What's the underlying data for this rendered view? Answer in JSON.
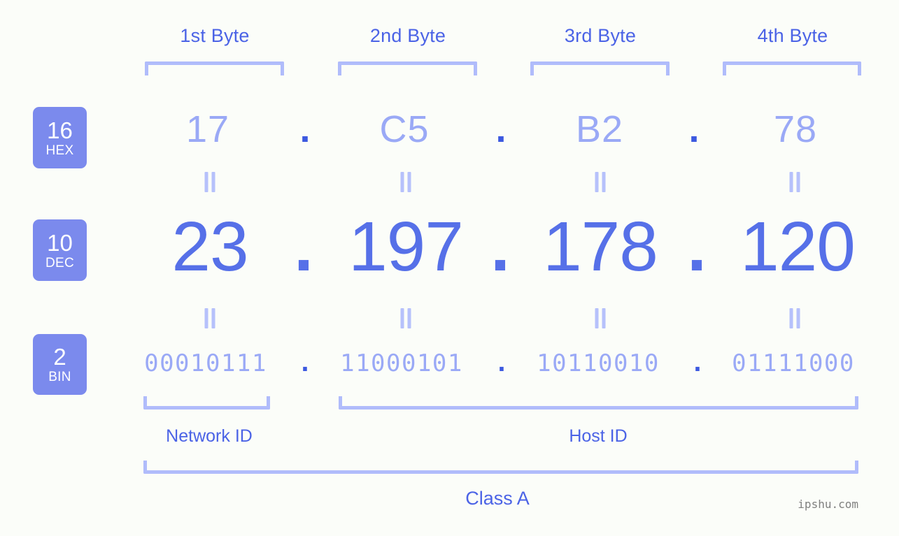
{
  "meta": {
    "ip_decimal": "23.197.178.120",
    "ip_class": "Class A",
    "watermark": "ipshu.com",
    "background_color": "#fbfdf9",
    "accent_color": "#5670e8",
    "light_accent_color": "#9aa9f6",
    "bracket_color": "#b0bcfb",
    "badge_color": "#7b8aed"
  },
  "byte_headers": [
    {
      "label": "1st Byte"
    },
    {
      "label": "2nd Byte"
    },
    {
      "label": "3rd Byte"
    },
    {
      "label": "4th Byte"
    }
  ],
  "bases": [
    {
      "number": "16",
      "name": "HEX"
    },
    {
      "number": "10",
      "name": "DEC"
    },
    {
      "number": "2",
      "name": "BIN"
    }
  ],
  "rows": {
    "hex": {
      "base_number": "16",
      "base_name": "HEX",
      "values": [
        "17",
        "C5",
        "B2",
        "78"
      ],
      "separator": "."
    },
    "dec": {
      "base_number": "10",
      "base_name": "DEC",
      "values": [
        "23",
        "197",
        "178",
        "120"
      ],
      "separator": "."
    },
    "bin": {
      "base_number": "2",
      "base_name": "BIN",
      "values": [
        "00010111",
        "11000101",
        "10110010",
        "01111000"
      ],
      "separator": "."
    }
  },
  "equivalence_symbol": "=",
  "sections": [
    {
      "label": "Network ID"
    },
    {
      "label": "Host ID"
    }
  ],
  "class_row": {
    "label": "Class A"
  }
}
